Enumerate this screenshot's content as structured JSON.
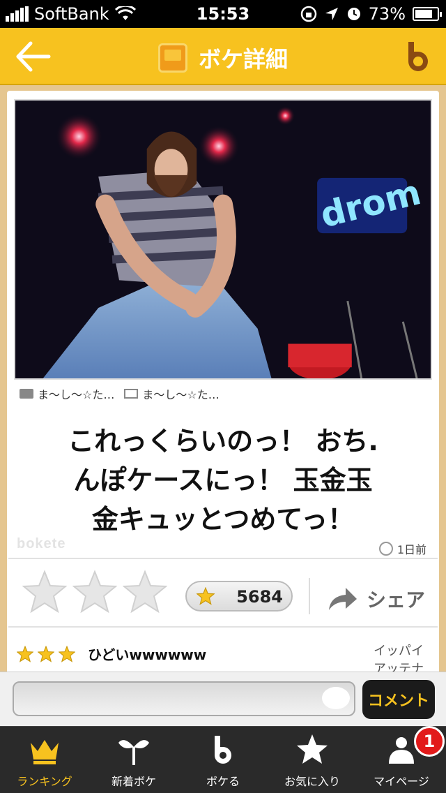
{
  "status_bar": {
    "carrier": "SoftBank",
    "time": "15:53",
    "battery": "73%"
  },
  "header": {
    "title": "ボケ詳細"
  },
  "post": {
    "photo_credit": "ま〜し〜☆た…",
    "caption_credit": "ま〜し〜☆た…",
    "caption_lines": [
      "これっくらいのっ！ おち.",
      "んぽケースにっ！ 玉金玉",
      "金キュッとつめてっ！"
    ],
    "watermark": "bokete",
    "age": "1日前",
    "rating_stars": 3,
    "score": "5684",
    "share_label": "シェア"
  },
  "top_comment": {
    "stars": 3,
    "text": "ひどいwwwwww",
    "source_lines": [
      "イッパイ",
      "アッテナ"
    ]
  },
  "comment_bar": {
    "placeholder": "",
    "button_label": "コメント"
  },
  "tabs": [
    {
      "label": "ランキング",
      "icon": "crown-icon",
      "active": true
    },
    {
      "label": "新着ボケ",
      "icon": "sprout-icon",
      "active": false
    },
    {
      "label": "ボケる",
      "icon": "bokete-b-icon",
      "active": false
    },
    {
      "label": "お気に入り",
      "icon": "star-icon",
      "active": false
    },
    {
      "label": "マイページ",
      "icon": "person-icon",
      "active": false
    }
  ],
  "mypage_badge": "1",
  "colors": {
    "accent": "#f7c21f",
    "tabbar": "#2a2a2a",
    "badge": "#e21a1a"
  }
}
